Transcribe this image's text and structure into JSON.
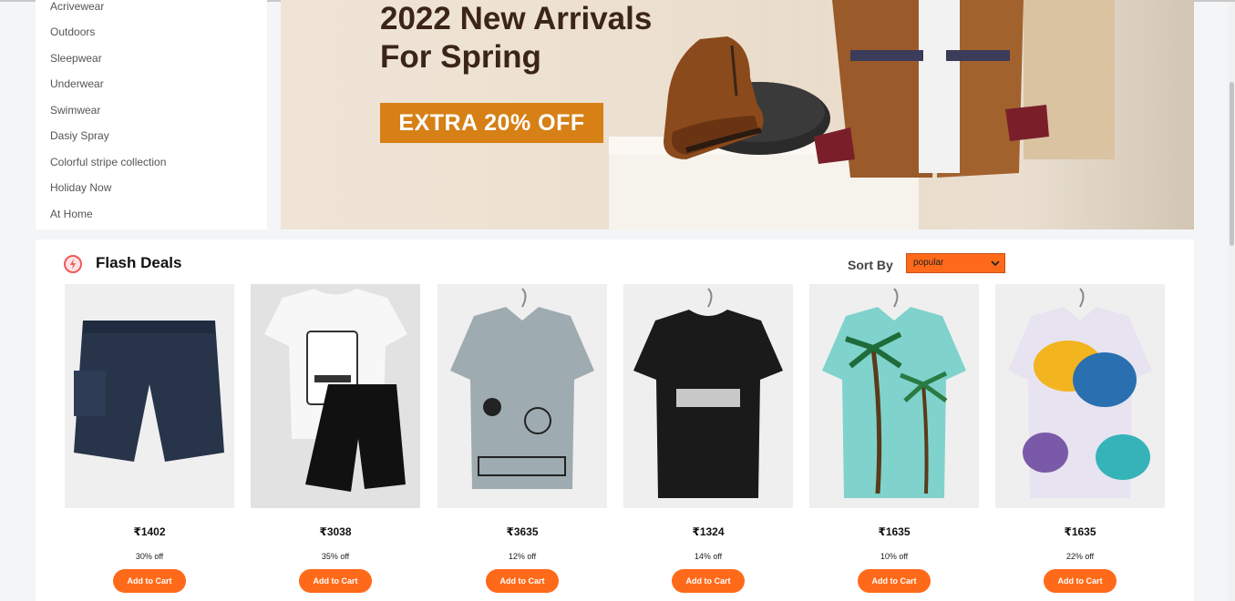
{
  "sidebar": {
    "items": [
      {
        "label": "Acrivewear"
      },
      {
        "label": "Outdoors"
      },
      {
        "label": "Sleepwear"
      },
      {
        "label": "Underwear"
      },
      {
        "label": "Swimwear"
      },
      {
        "label": "Dasiy Spray"
      },
      {
        "label": "Colorful stripe collection"
      },
      {
        "label": "Holiday Now"
      },
      {
        "label": "At Home"
      }
    ]
  },
  "banner": {
    "headline_line1": "2022 New Arrivals",
    "headline_line2": "For Spring",
    "promo": "EXTRA 20% OFF"
  },
  "deals": {
    "title": "Flash Deals",
    "sort_label": "Sort By",
    "sort_selected": "popular",
    "products": [
      {
        "price": "₹1402",
        "discount": "30% off",
        "cta": "Add to Cart",
        "image": "navy-shorts"
      },
      {
        "price": "₹3038",
        "discount": "35% off",
        "cta": "Add to Cart",
        "image": "tshirt-shorts-set"
      },
      {
        "price": "₹3635",
        "discount": "12% off",
        "cta": "Add to Cart",
        "image": "grey-graphic-shirt"
      },
      {
        "price": "₹1324",
        "discount": "14% off",
        "cta": "Add to Cart",
        "image": "black-tshirt"
      },
      {
        "price": "₹1635",
        "discount": "10% off",
        "cta": "Add to Cart",
        "image": "palm-print-shirt"
      },
      {
        "price": "₹1635",
        "discount": "22% off",
        "cta": "Add to Cart",
        "image": "butterfly-print-shirt"
      }
    ]
  },
  "colors": {
    "accent": "#ff6a1a",
    "promo_bg": "#d68016",
    "headline": "#3b2418"
  }
}
